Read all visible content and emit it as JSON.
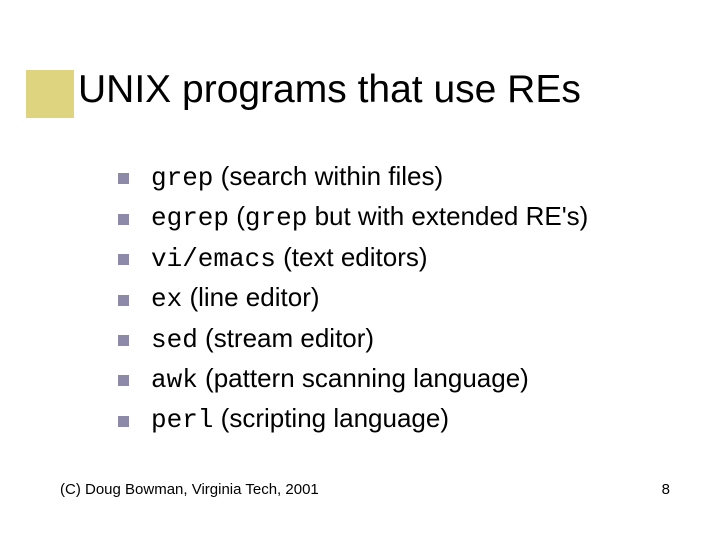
{
  "title": "UNIX programs that use REs",
  "bullets": [
    {
      "cmd": "grep",
      "sp": " ",
      "pre": "",
      "mid": "",
      "desc": "(search within files)"
    },
    {
      "cmd": "egrep",
      "sp": " ",
      "pre": "(",
      "mid": "grep",
      "desc": " but with extended RE's)"
    },
    {
      "cmd": "vi/emacs",
      "sp": " ",
      "pre": "",
      "mid": "",
      "desc": "(text editors)"
    },
    {
      "cmd": "ex",
      "sp": " ",
      "pre": "",
      "mid": "",
      "desc": "(line editor)"
    },
    {
      "cmd": "sed",
      "sp": " ",
      "pre": "",
      "mid": "",
      "desc": "(stream editor)"
    },
    {
      "cmd": "awk",
      "sp": " ",
      "pre": "",
      "mid": "",
      "desc": "(pattern scanning language)"
    },
    {
      "cmd": "perl",
      "sp": " ",
      "pre": "",
      "mid": "",
      "desc": "(scripting language)"
    }
  ],
  "footer": {
    "left": "(C) Doug Bowman, Virginia Tech, 2001",
    "right": "8"
  }
}
